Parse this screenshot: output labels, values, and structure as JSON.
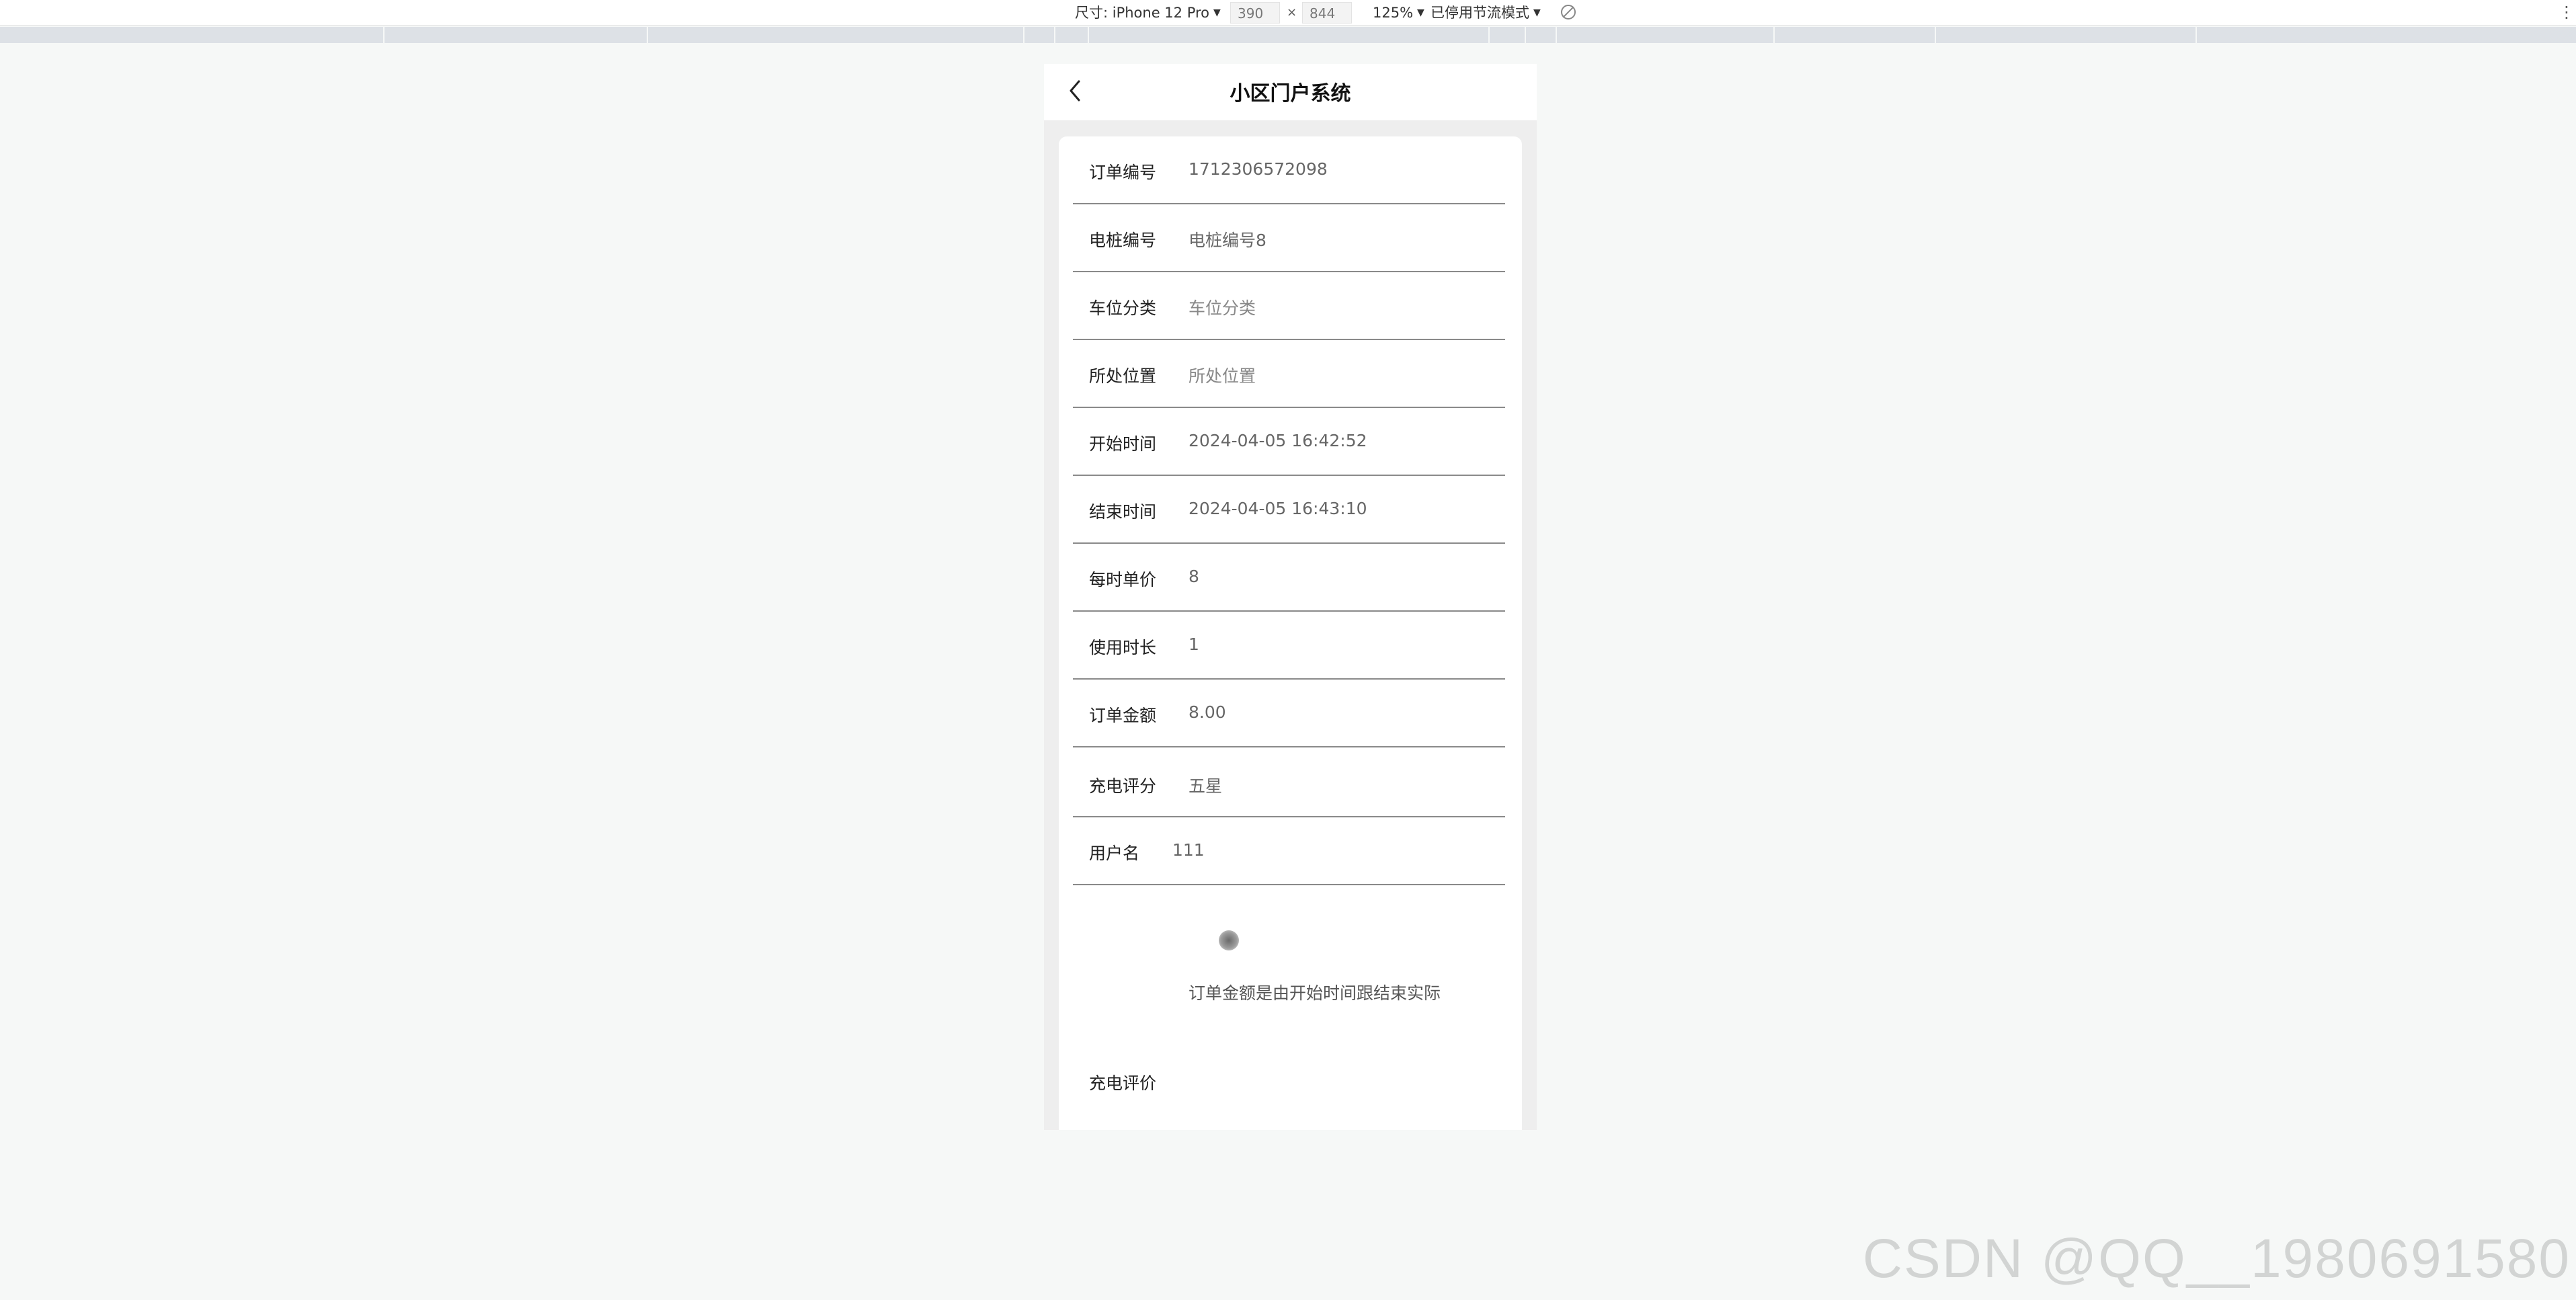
{
  "devtools": {
    "device_label": "尺寸: iPhone 12 Pro",
    "width_value": "390",
    "times": "×",
    "height_value": "844",
    "zoom": "125%",
    "throttle": "已停用节流模式",
    "icons": [
      "caret-down-icon",
      "throttle-off-icon",
      "more-vert-icon"
    ]
  },
  "app": {
    "title": "小区门户系统",
    "back_icon": "chevron-left-icon"
  },
  "form": {
    "rows": [
      {
        "label": "订单编号",
        "value": "1712306572098"
      },
      {
        "label": "电桩编号",
        "value": "电桩编号8"
      },
      {
        "label": "车位分类",
        "value": "车位分类"
      },
      {
        "label": "所处位置",
        "value": "所处位置"
      },
      {
        "label": "开始时间",
        "value": "2024-04-05 16:42:52"
      },
      {
        "label": "结束时间",
        "value": "2024-04-05 16:43:10"
      },
      {
        "label": "每时单价",
        "value": "8"
      },
      {
        "label": "使用时长",
        "value": "1"
      },
      {
        "label": "订单金额",
        "value": "8.00"
      },
      {
        "label": "充电评分",
        "value": "五星"
      },
      {
        "label": "用户名",
        "value": "111"
      }
    ],
    "note": "订单金额是由开始时间跟结束实际",
    "eval_label": "充电评价"
  },
  "watermark": "CSDN @QQ__1980691580",
  "colors": {
    "page_bg": "#f6f8f7",
    "card_bg": "#ffffff",
    "divider": "#8a8a8a",
    "ruler": "#dde1e6"
  }
}
